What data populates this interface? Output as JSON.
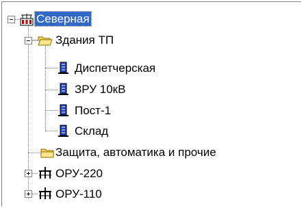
{
  "tree": {
    "root": {
      "label": "Северная",
      "icon": "substation-icon",
      "expanded": true,
      "selected": true
    },
    "buildings": {
      "label": "Здания ТП",
      "icon": "folder-open-icon",
      "expanded": true
    },
    "building_items": [
      {
        "label": "Диспетчерская",
        "icon": "building-icon"
      },
      {
        "label": "ЗРУ 10кВ",
        "icon": "building-icon"
      },
      {
        "label": "Пост-1",
        "icon": "building-icon"
      },
      {
        "label": "Склад",
        "icon": "building-icon"
      }
    ],
    "protection": {
      "label": "Защита, автоматика и прочие",
      "icon": "folder-icon"
    },
    "oru": [
      {
        "label": "ОРУ-220",
        "icon": "switchgear-icon",
        "expanded": false
      },
      {
        "label": "ОРУ-110",
        "icon": "switchgear-icon",
        "expanded": false
      }
    ]
  },
  "colors": {
    "selection": "#316ac5",
    "folder": "#f5d35a",
    "building": "#1f3fbf"
  }
}
